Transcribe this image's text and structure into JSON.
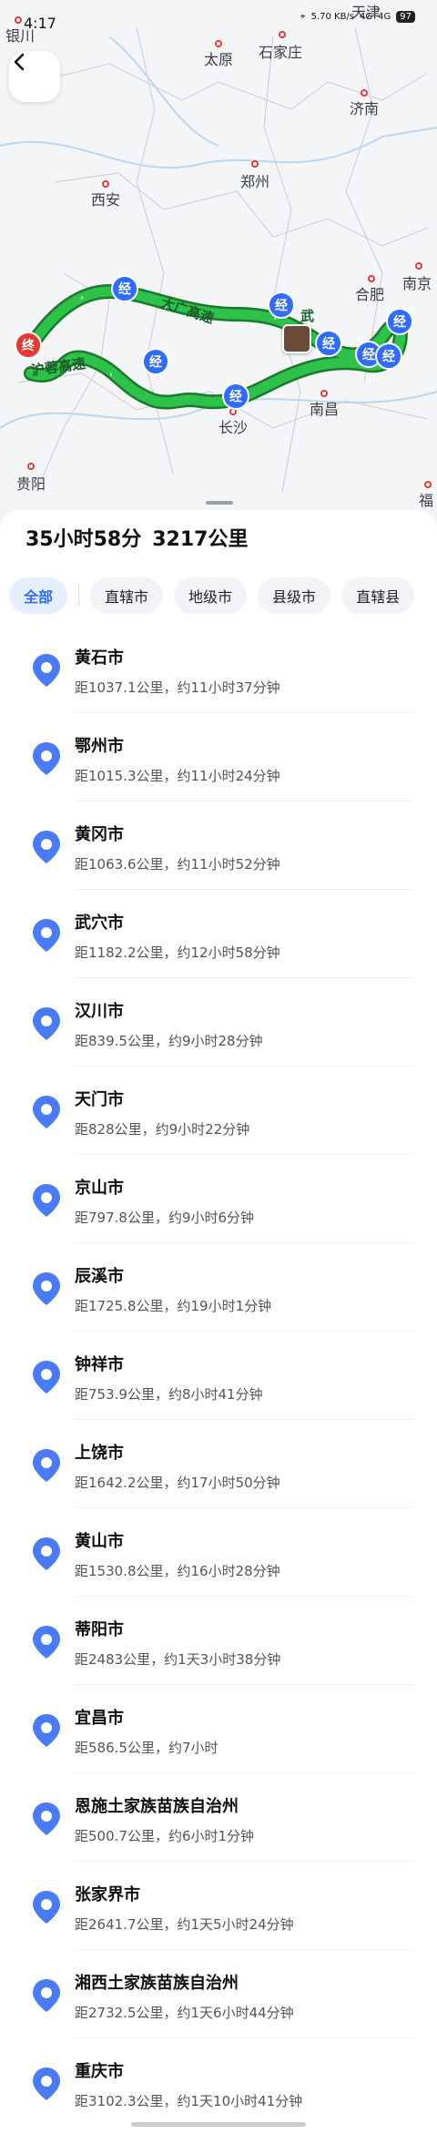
{
  "status": {
    "time": "4:17",
    "net_speed": "5.70 KB/s",
    "signal1": "4G",
    "signal2": "4G",
    "battery": "97"
  },
  "map": {
    "cities": [
      {
        "name": "银川"
      },
      {
        "name": "太原"
      },
      {
        "name": "石家庄"
      },
      {
        "name": "天津"
      },
      {
        "name": "济南"
      },
      {
        "name": "西安"
      },
      {
        "name": "郑州"
      },
      {
        "name": "合肥"
      },
      {
        "name": "南京"
      },
      {
        "name": "南昌"
      },
      {
        "name": "长沙"
      },
      {
        "name": "贵阳"
      },
      {
        "name": "福"
      }
    ],
    "road_labels": [
      "大广高速",
      "沪蓉高速",
      "武"
    ],
    "end_marker": "终",
    "waypoint_marker": "经",
    "colors": {
      "route": "#2ec24a",
      "route_border": "#1a7a2b",
      "waypoint": "#2f6bff",
      "end": "#e53935"
    }
  },
  "summary": {
    "duration": "35小时58分",
    "distance": "3217公里"
  },
  "filters": [
    {
      "label": "全部",
      "active": true
    },
    {
      "label": "直辖市",
      "active": false
    },
    {
      "label": "地级市",
      "active": false
    },
    {
      "label": "县级市",
      "active": false
    },
    {
      "label": "直辖县",
      "active": false
    }
  ],
  "cities_list": [
    {
      "name": "黄石市",
      "info": "距1037.1公里，约11小时37分钟"
    },
    {
      "name": "鄂州市",
      "info": "距1015.3公里，约11小时24分钟"
    },
    {
      "name": "黄冈市",
      "info": "距1063.6公里，约11小时52分钟"
    },
    {
      "name": "武穴市",
      "info": "距1182.2公里，约12小时58分钟"
    },
    {
      "name": "汉川市",
      "info": "距839.5公里，约9小时28分钟"
    },
    {
      "name": "天门市",
      "info": "距828公里，约9小时22分钟"
    },
    {
      "name": "京山市",
      "info": "距797.8公里，约9小时6分钟"
    },
    {
      "name": "辰溪市",
      "info": "距1725.8公里，约19小时1分钟"
    },
    {
      "name": "钟祥市",
      "info": "距753.9公里，约8小时41分钟"
    },
    {
      "name": "上饶市",
      "info": "距1642.2公里，约17小时50分钟"
    },
    {
      "name": "黄山市",
      "info": "距1530.8公里，约16小时28分钟"
    },
    {
      "name": "蒂阳市",
      "info": "距2483公里，约1天3小时38分钟"
    },
    {
      "name": "宜昌市",
      "info": "距586.5公里，约7小时"
    },
    {
      "name": "恩施土家族苗族自治州",
      "info": "距500.7公里，约6小时1分钟"
    },
    {
      "name": "张家界市",
      "info": "距2641.7公里，约1天5小时24分钟"
    },
    {
      "name": "湘西土家族苗族自治州",
      "info": "距2732.5公里，约1天6小时44分钟"
    },
    {
      "name": "重庆市",
      "info": "距3102.3公里，约1天10小时41分钟"
    }
  ]
}
